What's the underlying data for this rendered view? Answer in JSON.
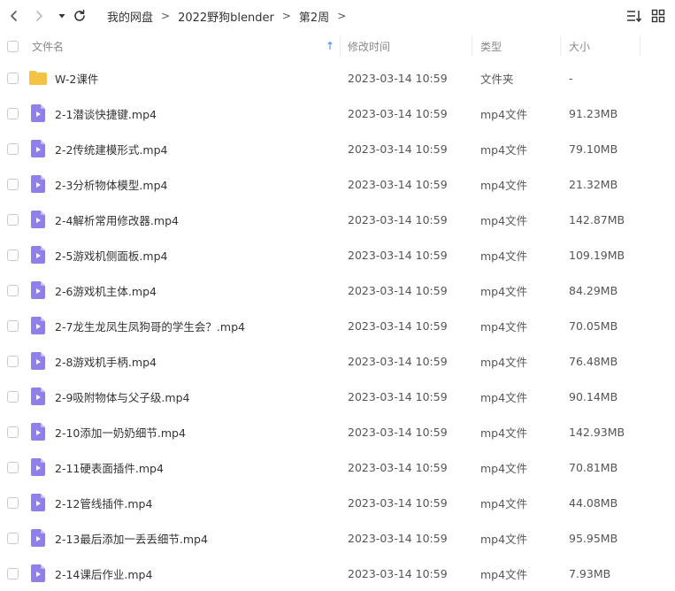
{
  "toolbar": {
    "back_icon": "chevron-left-icon",
    "forward_icon": "chevron-right-icon",
    "dropdown_icon": "caret-down-icon",
    "refresh_icon": "refresh-icon",
    "sort_icon": "sort-list-icon",
    "grid_icon": "grid-view-icon"
  },
  "breadcrumb": {
    "items": [
      "我的网盘",
      "2022野狗blender",
      "第2周"
    ],
    "separator": ">"
  },
  "columns": {
    "name": "文件名",
    "modified": "修改时间",
    "type": "类型",
    "size": "大小",
    "sort_arrow": "↑"
  },
  "colors": {
    "folder": "#f5c343",
    "video": "#8f7fe8",
    "sort_arrow": "#3b82f6"
  },
  "files": [
    {
      "icon": "folder-icon",
      "name": "W-2课件",
      "modified": "2023-03-14 10:59",
      "type": "文件夹",
      "size": "-"
    },
    {
      "icon": "video-file-icon",
      "name": "2-1潜谈快捷键.mp4",
      "modified": "2023-03-14 10:59",
      "type": "mp4文件",
      "size": "91.23MB"
    },
    {
      "icon": "video-file-icon",
      "name": "2-2传统建模形式.mp4",
      "modified": "2023-03-14 10:59",
      "type": "mp4文件",
      "size": "79.10MB"
    },
    {
      "icon": "video-file-icon",
      "name": "2-3分析物体模型.mp4",
      "modified": "2023-03-14 10:59",
      "type": "mp4文件",
      "size": "21.32MB"
    },
    {
      "icon": "video-file-icon",
      "name": "2-4解析常用修改器.mp4",
      "modified": "2023-03-14 10:59",
      "type": "mp4文件",
      "size": "142.87MB"
    },
    {
      "icon": "video-file-icon",
      "name": "2-5游戏机侧面板.mp4",
      "modified": "2023-03-14 10:59",
      "type": "mp4文件",
      "size": "109.19MB"
    },
    {
      "icon": "video-file-icon",
      "name": "2-6游戏机主体.mp4",
      "modified": "2023-03-14 10:59",
      "type": "mp4文件",
      "size": "84.29MB"
    },
    {
      "icon": "video-file-icon",
      "name": "2-7龙生龙凤生凤狗哥的学生会？.mp4",
      "modified": "2023-03-14 10:59",
      "type": "mp4文件",
      "size": "70.05MB"
    },
    {
      "icon": "video-file-icon",
      "name": "2-8游戏机手柄.mp4",
      "modified": "2023-03-14 10:59",
      "type": "mp4文件",
      "size": "76.48MB"
    },
    {
      "icon": "video-file-icon",
      "name": "2-9吸附物体与父子级.mp4",
      "modified": "2023-03-14 10:59",
      "type": "mp4文件",
      "size": "90.14MB"
    },
    {
      "icon": "video-file-icon",
      "name": "2-10添加一奶奶细节.mp4",
      "modified": "2023-03-14 10:59",
      "type": "mp4文件",
      "size": "142.93MB"
    },
    {
      "icon": "video-file-icon",
      "name": "2-11硬表面插件.mp4",
      "modified": "2023-03-14 10:59",
      "type": "mp4文件",
      "size": "70.81MB"
    },
    {
      "icon": "video-file-icon",
      "name": "2-12管线插件.mp4",
      "modified": "2023-03-14 10:59",
      "type": "mp4文件",
      "size": "44.08MB"
    },
    {
      "icon": "video-file-icon",
      "name": "2-13最后添加一丢丢细节.mp4",
      "modified": "2023-03-14 10:59",
      "type": "mp4文件",
      "size": "95.95MB"
    },
    {
      "icon": "video-file-icon",
      "name": "2-14课后作业.mp4",
      "modified": "2023-03-14 10:59",
      "type": "mp4文件",
      "size": "7.93MB"
    }
  ]
}
